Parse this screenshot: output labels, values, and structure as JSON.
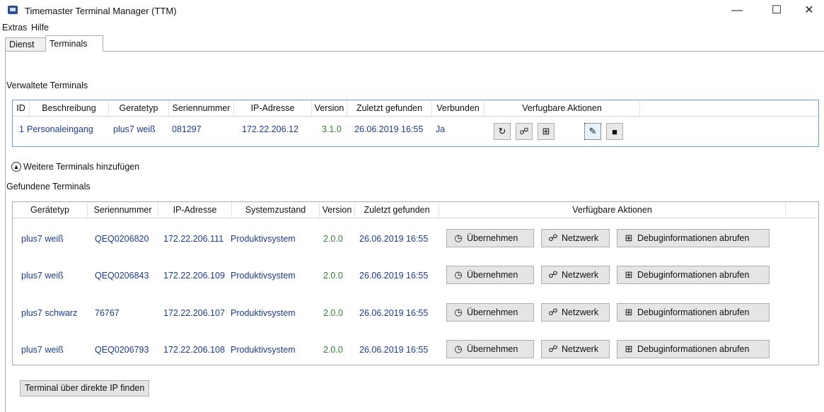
{
  "window": {
    "title": "Timemaster Terminal Manager (TTM)",
    "minimize": "—",
    "maximize": "☐",
    "close": "✕"
  },
  "menu": {
    "extras": "Extras",
    "hilfe": "Hilfe"
  },
  "tabs": {
    "dienst": "Dienst",
    "terminals": "Terminals"
  },
  "managed": {
    "section_label": "Verwaltete Terminals",
    "headers": [
      "ID",
      "Beschreibung",
      "Geratetyp",
      "Seriennummer",
      "IP-Adresse",
      "Version",
      "Zuletzt gefunden",
      "Verbunden",
      "Verfugbare Aktionen"
    ],
    "rows": [
      {
        "id": "1",
        "beschreibung": "Personaleingang",
        "typ": "plus7 weiß",
        "serial": "081297",
        "ip": "172.22.206.12",
        "version": "3.1.0",
        "zuletzt": "26.06.2019 16:55",
        "verbunden": "Ja"
      }
    ],
    "action_icons": [
      "refresh-icon",
      "network-icon",
      "debug-icon",
      "edit-icon",
      "delete-icon"
    ]
  },
  "expander_label": "Weitere Terminals hinzufügen",
  "found": {
    "section_label": "Gefundene Terminals",
    "headers": [
      "Gerätetyp",
      "Seriennummer",
      "IP-Adresse",
      "Systemzustand",
      "Version",
      "Zuletzt gefunden",
      "Verfügbare Aktionen"
    ],
    "rows": [
      {
        "typ": "plus7 weiß",
        "serial": "QEQ0206820",
        "ip": "172.22.206.111",
        "zustand": "Produktivsystem",
        "version": "2.0.0",
        "zuletzt": "26.06.2019 16:55"
      },
      {
        "typ": "plus7 weiß",
        "serial": "QEQ0206843",
        "ip": "172.22.206.109",
        "zustand": "Produktivsystem",
        "version": "2.0.0",
        "zuletzt": "26.06.2019 16:55"
      },
      {
        "typ": "plus7 schwarz",
        "serial": "76767",
        "ip": "172.22.206.107",
        "zustand": "Produktivsystem",
        "version": "2.0.0",
        "zuletzt": "26.06.2019 16:55"
      },
      {
        "typ": "plus7 weiß",
        "serial": "QEQ0206793",
        "ip": "172.22.206.108",
        "zustand": "Produktivsystem",
        "version": "2.0.0",
        "zuletzt": "26.06.2019 16:55"
      }
    ],
    "actions": {
      "uebernehmen": "Übernehmen",
      "netzwerk": "Netzwerk",
      "debug": "Debuginformationen abrufen"
    }
  },
  "find_ip_button": "Terminal über direkte IP finden"
}
